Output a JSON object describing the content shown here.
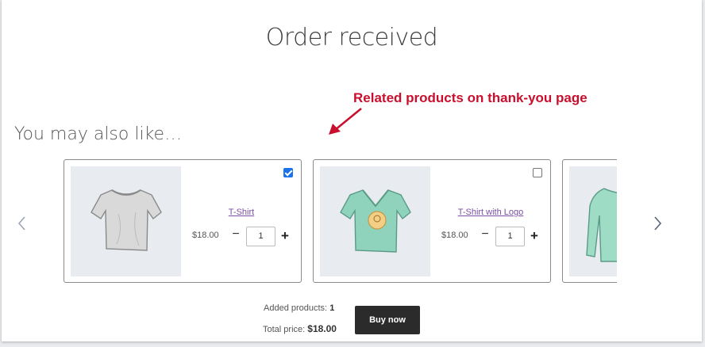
{
  "page": {
    "title": "Order received"
  },
  "annotation": {
    "text": "Related products on thank-you page",
    "color": "#c8102e"
  },
  "related": {
    "heading": "You may also like…",
    "prev_icon": "chevron-left-icon",
    "next_icon": "chevron-right-icon",
    "products": [
      {
        "name": "T-Shirt",
        "price": "$18.00",
        "quantity": "1",
        "selected": true,
        "image": "grey-tshirt"
      },
      {
        "name": "T-Shirt with Logo",
        "price": "$18.00",
        "quantity": "1",
        "selected": false,
        "image": "mint-vneck-tshirt-with-logo"
      },
      {
        "name": "",
        "price": "",
        "quantity": "",
        "selected": false,
        "image": "mint-long-sleeve-shirt"
      }
    ]
  },
  "summary": {
    "added_label": "Added products:",
    "added_count": "1",
    "total_label": "Total price:",
    "total_price": "$18.00",
    "buy_label": "Buy now"
  },
  "colors": {
    "accent_checkbox": "#1a73e8",
    "link": "#7b4fa3",
    "button_bg": "#2b2b2b",
    "image_bg": "#e8ebef"
  }
}
